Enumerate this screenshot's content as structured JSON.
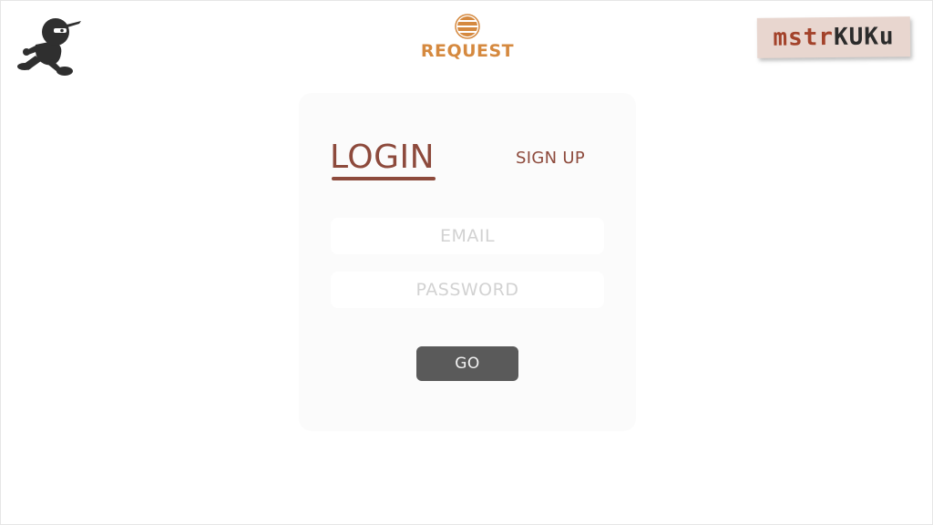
{
  "header": {
    "brand_name": "REQUEST",
    "badge_part1": "mstr",
    "badge_part2": "KUKu",
    "brand_color": "#d5893f",
    "mascot_icon": "running-ninja-icon",
    "brand_icon": "striped-globe-icon"
  },
  "auth": {
    "tabs": {
      "login_label": "LOGIN",
      "signup_label": "SIGN UP",
      "active": "login"
    },
    "email": {
      "placeholder": "EMAIL",
      "value": ""
    },
    "password": {
      "placeholder": "PASSWORD",
      "value": ""
    },
    "submit_label": "GO"
  },
  "colors": {
    "accent": "#8d4a3c",
    "button": "#5a5a5a",
    "card": "#fbfbfb",
    "badge_bg": "#e8d6cf"
  }
}
